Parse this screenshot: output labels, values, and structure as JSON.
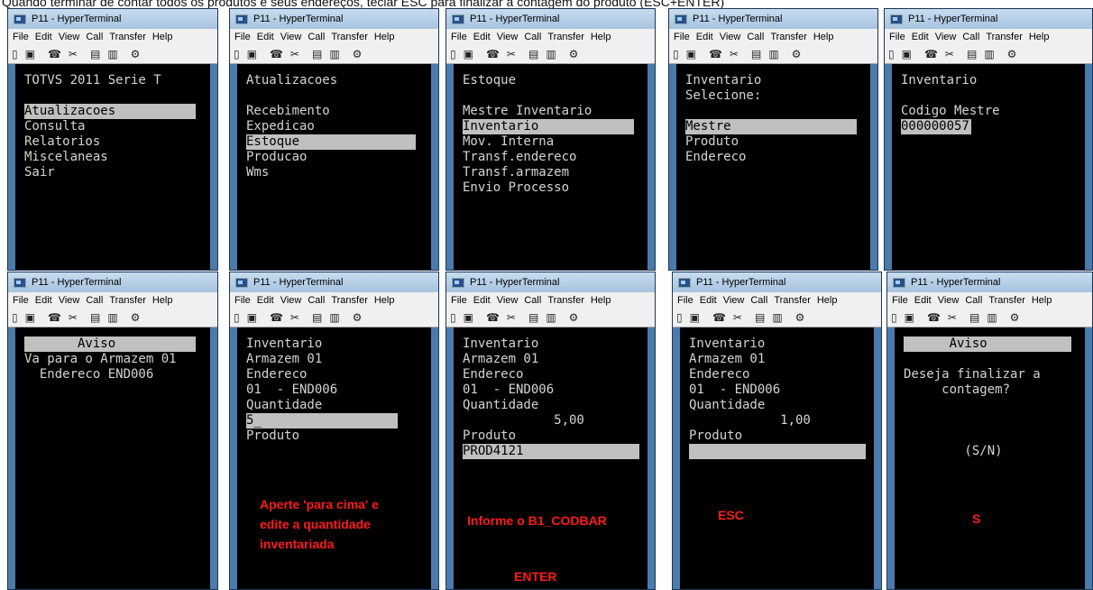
{
  "caption": "Quando terminar de contar todos os produtos e seus endereços, teclar ESC para finalizar a contagem do produto (ESC+ENTER)",
  "window_title": "P11 - HyperTerminal",
  "menu": [
    "File",
    "Edit",
    "View",
    "Call",
    "Transfer",
    "Help"
  ],
  "toolbar_icons": [
    "new-icon",
    "open-icon",
    "phone-icon",
    "disconnect-icon",
    "send-icon",
    "receive-icon",
    "properties-icon"
  ],
  "screens": [
    {
      "lines": [
        "TOTVS 2011 Serie T",
        "",
        "Atualizacoes",
        "Consulta",
        "Relatorios",
        "Miscelaneas",
        "Sair"
      ],
      "hl": 2
    },
    {
      "lines": [
        "Atualizacoes",
        "",
        "Recebimento",
        "Expedicao",
        "Estoque",
        "Producao",
        "Wms"
      ],
      "hl": 4
    },
    {
      "lines": [
        "Estoque",
        "",
        "Mestre Inventario",
        "Inventario",
        "Mov. Interna",
        "Transf.endereco",
        "Transf.armazem",
        "Envio Processo"
      ],
      "hl": 3
    },
    {
      "lines": [
        "Inventario",
        "Selecione:",
        "",
        "Mestre",
        "Produto",
        "Endereco"
      ],
      "hl": 3
    },
    {
      "lines": [
        "Inventario",
        "",
        "Codigo Mestre",
        "000000057"
      ],
      "hl": 3
    },
    {
      "lines": [
        "       Aviso",
        "Va para o Armazem 01",
        "  Endereco END006"
      ],
      "hl": 0
    },
    {
      "lines": [
        "Inventario",
        "Armazem 01",
        "Endereco",
        "01  - END006",
        "Quantidade",
        "5_",
        "Produto"
      ],
      "hl": 5
    },
    {
      "lines": [
        "Inventario",
        "Armazem 01",
        "Endereco",
        "01  - END006",
        "Quantidade",
        "            5,00",
        "Produto",
        "PROD4121"
      ],
      "hl": 7
    },
    {
      "lines": [
        "Inventario",
        "Armazem 01",
        "Endereco",
        "01  - END006",
        "Quantidade",
        "            1,00",
        "Produto",
        ""
      ],
      "hl": 7
    },
    {
      "lines": [
        "      Aviso",
        "",
        "Deseja finalizar a",
        "     contagem?",
        "",
        "",
        "",
        "        (S/N)"
      ],
      "hl": 0
    }
  ],
  "notes": {
    "n6": [
      "Aperte 'para cima' e",
      "edite a quantidade",
      "inventariada"
    ],
    "n7a": "Informe o B1_CODBAR",
    "n7b": "ENTER",
    "n8": "ESC",
    "n9": "S"
  },
  "colors": {
    "note_red": "#ff1a1a",
    "highlight": "#c0c0c0",
    "terminal_bg": "#000000"
  }
}
